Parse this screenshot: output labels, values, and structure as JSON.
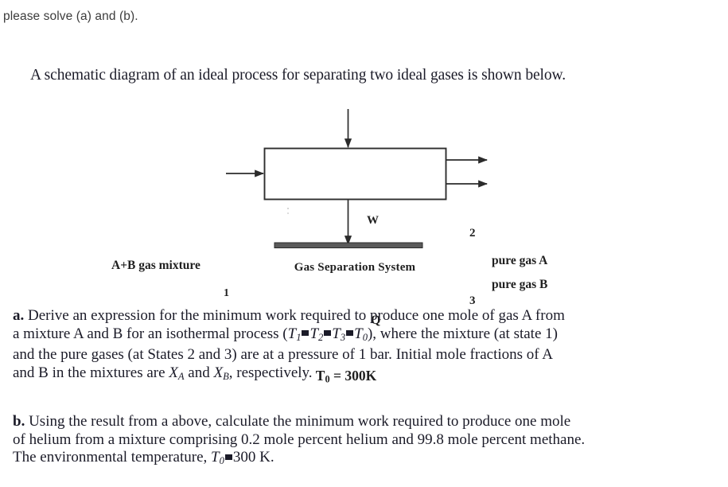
{
  "prompt": {
    "text": "please solve (a) and (b)."
  },
  "problem": {
    "title": "A schematic diagram of an ideal process for separating two ideal gases is shown below.",
    "part_a": {
      "marker": "a.",
      "lines": [
        "Derive an expression for the minimum work required to produce one mole of gas A from",
        "a mixture A and B for an isothermal process (T₁=T₂=T₃=T₀), where the mixture (at state 1)",
        "and the pure gases (at States 2 and 3) are at a pressure of 1 bar. Initial mole fractions of A",
        "and B in the mixtures are Xₐ and Xʙ, respectively."
      ],
      "line1": "Derive an expression for the minimum work required to produce one mole of gas A from",
      "line2_pre": "a mixture A and B for an isothermal process (",
      "line2_post": "), where the mixture (at state 1)",
      "line3": "and the pure gases (at States 2 and 3) are at a pressure of 1 bar. Initial mole fractions of A",
      "line4_pre": "and B in the mixtures are ",
      "line4_mid": " and ",
      "line4_post": ", respectively.",
      "temps": [
        "T",
        "T",
        "T",
        "T"
      ],
      "temp_subs": [
        "1",
        "2",
        "3",
        "0"
      ],
      "mole_fraction_symbol": "X",
      "mole_fraction_a_sub": "A",
      "mole_fraction_b_sub": "B",
      "pressure": "1 bar",
      "states": [
        "1",
        "2",
        "3"
      ]
    },
    "part_b": {
      "marker": "b.",
      "lines": [
        "Using the result from a above, calculate the minimum work required to produce one mole",
        "of helium from a mixture comprising 0.2 mole percent helium and 99.8 mole percent methane.",
        "The environmental temperature, T₀=300 K."
      ],
      "line1": "Using the result from a above, calculate the minimum work required to produce one mole",
      "line2": "of helium from a mixture comprising 0.2 mole percent helium and 99.8 mole percent methane.",
      "line3_pre": "The environmental temperature, ",
      "line3_post": "300 K.",
      "temp_symbol": "T",
      "temp_sub": "0",
      "helium_percent": "0.2 mole percent",
      "methane_percent": "99.8 mole percent",
      "environment_temperature": "300 K"
    }
  },
  "diagram": {
    "system_box_label": "Gas Separation System",
    "inlet_label": "A+B gas mixture",
    "inlet_state": "1",
    "work_label": "W",
    "heat_label": "Q",
    "outlet_a_label": "pure gas A",
    "outlet_b_label": "pure gas B",
    "outlet_a_state": "2",
    "outlet_b_state": "3",
    "reservoir_temperature": "T",
    "reservoir_temperature_sub": "0",
    "reservoir_temperature_value": "= 300K",
    "line_color": "#333333",
    "box_fill": "#ffffff"
  }
}
